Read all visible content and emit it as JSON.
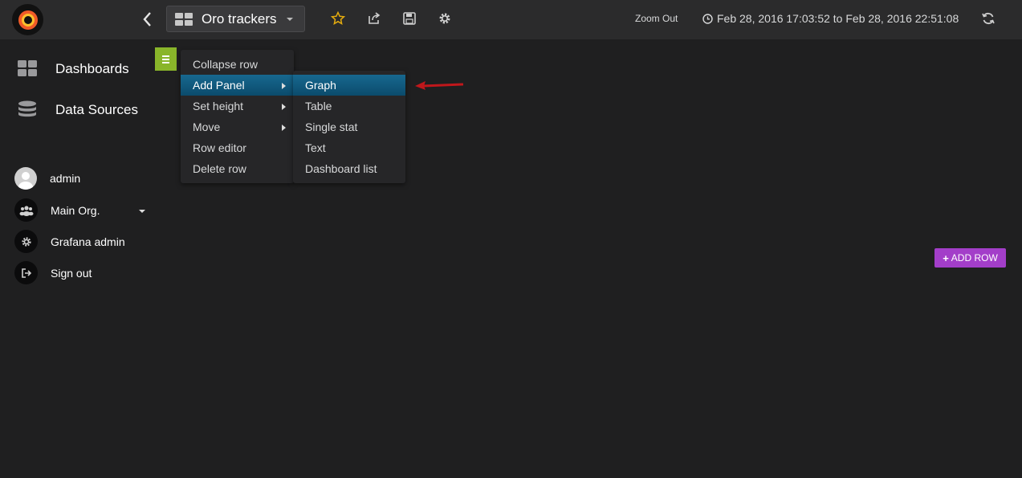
{
  "topbar": {
    "dashboard_title": "Oro trackers",
    "zoom_out_label": "Zoom Out",
    "time_range": "Feb 28, 2016 17:03:52 to Feb 28, 2016 22:51:08",
    "icons": [
      "grafana-logo-icon",
      "back-chevron-icon",
      "dashboard-grid-icon",
      "star-icon",
      "share-icon",
      "save-icon",
      "gear-icon",
      "clock-icon",
      "refresh-icon"
    ],
    "star_color": "#e5ac0e"
  },
  "sidebar": {
    "items": [
      {
        "label": "Dashboards",
        "icon": "dashboards-grid-icon"
      },
      {
        "label": "Data Sources",
        "icon": "database-icon"
      }
    ],
    "user_items": [
      {
        "label": "admin",
        "icon": "avatar"
      },
      {
        "label": "Main Org.",
        "icon": "users-icon"
      },
      {
        "label": "Grafana admin",
        "icon": "gear-icon"
      },
      {
        "label": "Sign out",
        "icon": "sign-out-icon"
      }
    ]
  },
  "row_menu": {
    "items": [
      {
        "label": "Collapse row"
      },
      {
        "label": "Add Panel"
      },
      {
        "label": "Set height"
      },
      {
        "label": "Move"
      },
      {
        "label": "Row editor"
      },
      {
        "label": "Delete row"
      }
    ],
    "active": "Add Panel"
  },
  "panel_submenu": {
    "items": [
      {
        "label": "Graph"
      },
      {
        "label": "Table"
      },
      {
        "label": "Single stat"
      },
      {
        "label": "Text"
      },
      {
        "label": "Dashboard list"
      }
    ],
    "active": "Graph"
  },
  "add_row_label": "ADD ROW",
  "colors": {
    "row_button": "#89b52a",
    "add_row": "#a33ec9",
    "menu_active": "#0f5a82",
    "annotation_arrow": "#c0171b"
  }
}
